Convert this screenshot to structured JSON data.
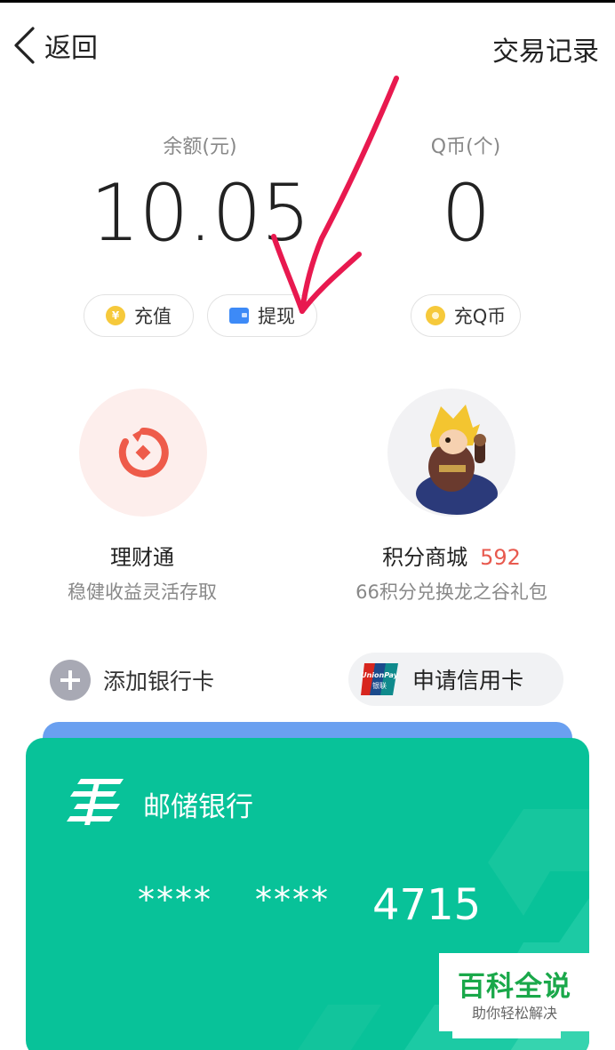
{
  "nav": {
    "back_label": "返回",
    "transactions_label": "交易记录"
  },
  "balance": {
    "label": "余额(元)",
    "value": "10.05",
    "recharge_label": "充值",
    "withdraw_label": "提现"
  },
  "qcoin": {
    "label": "Q币(个)",
    "value": "0",
    "recharge_label": "充Q币"
  },
  "tiles": [
    {
      "title": "理财通",
      "subtitle": "稳健收益灵活存取"
    },
    {
      "title": "积分商城",
      "points": "592",
      "subtitle": "66积分兑换龙之谷礼包"
    }
  ],
  "cards": {
    "add_label": "添加银行卡",
    "credit_label": "申请信用卡",
    "unionpay_logo_text": "UnionPay 银联",
    "bank_name": "邮储银行",
    "mask_1": "****",
    "mask_2": "****",
    "last4": "4715"
  },
  "watermark": {
    "title": "百科全说",
    "subtitle": "助你轻松解决"
  },
  "colors": {
    "card_green": "#08c299",
    "card_blue": "#6aa0f0",
    "points_red": "#e85a4f",
    "coin_gold": "#f6c93b",
    "annotation_red": "#e8194f"
  },
  "icons": [
    "chevron-left-icon",
    "yen-coin-icon",
    "wallet-icon",
    "coin-icon",
    "licaitong-icon",
    "game-avatar-icon",
    "plus-icon",
    "unionpay-icon",
    "postal-bank-logo-icon",
    "annotation-arrow"
  ]
}
